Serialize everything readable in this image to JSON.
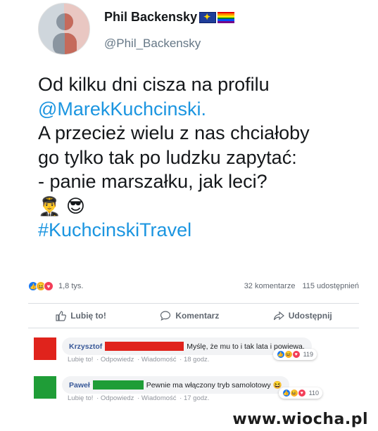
{
  "tweet": {
    "author_name": "Phil Backensky",
    "author_handle": "@Phil_Backensky",
    "lines": [
      "Od kilku dni cisza na profilu",
      "@MarekKuchcinski.",
      "A przecież wielu z nas chciałoby",
      "go tylko tak po ludzku zapytać:",
      "- panie marszałku, jak leci?"
    ],
    "emojis": [
      "👨‍✈️",
      "😎"
    ],
    "hashtag": "#KuchcinskiTravel",
    "colors": {
      "link": "#1b95e0",
      "eu_flag": "#1f3d99"
    },
    "rainbow_stripes": [
      "#e40303",
      "#ff8c00",
      "#ffed00",
      "#008026",
      "#004dff",
      "#750787"
    ]
  },
  "post": {
    "reaction_count": "1,8 tys.",
    "comments_count": "32 komentarze",
    "shares_count": "115 udostępnień",
    "actions": {
      "like": "Lubię to!",
      "comment": "Komentarz",
      "share": "Udostępnij"
    }
  },
  "comments": [
    {
      "author": "Krzysztof",
      "text": "Myślę, że mu to i tak lata i powiewa.",
      "avatar_color": "#e0231c",
      "redact_color": "#e0231c",
      "meta": {
        "like": "Lubię to!",
        "reply": "Odpowiedz",
        "message": "Wiadomość",
        "time": "18 godz."
      },
      "reactions": "119"
    },
    {
      "author": "Paweł",
      "text": "Pewnie ma włączony tryb samolotowy 😆",
      "avatar_color": "#1f9d37",
      "redact_color": "#1f9d37",
      "meta": {
        "like": "Lubię to!",
        "reply": "Odpowiedz",
        "message": "Wiadomość",
        "time": "17 godz."
      },
      "reactions": "110"
    }
  ],
  "watermark": "www.wiocha.pl"
}
